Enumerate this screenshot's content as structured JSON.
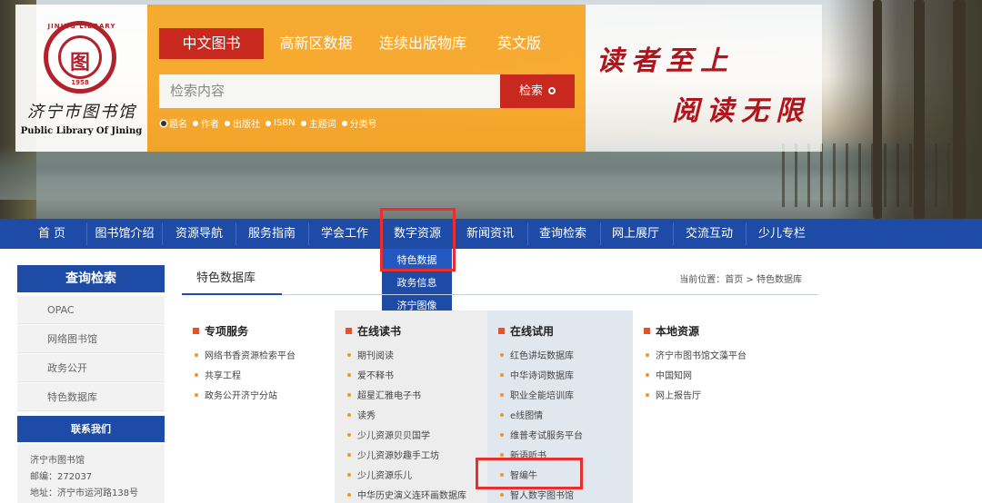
{
  "logo": {
    "cn": "济宁市图书馆",
    "en": "Public Library Of Jining",
    "seal_arc": "JINING LIBRARY",
    "seal_glyph": "图",
    "seal_year": "1958"
  },
  "search": {
    "tabs": [
      "中文图书",
      "高新区数据",
      "连续出版物库",
      "英文版"
    ],
    "active_tab": 0,
    "placeholder": "检索内容",
    "button": "检索",
    "options": [
      "题名",
      "作者",
      "出版社",
      "ISBN",
      "主题词",
      "分类号"
    ],
    "selected_option": 0
  },
  "slogan": {
    "line1": "读者至上",
    "line2": "阅读无限"
  },
  "nav": {
    "items": [
      "首 页",
      "图书馆介绍",
      "资源导航",
      "服务指南",
      "学会工作",
      "数字资源",
      "新闻资讯",
      "查询检索",
      "网上展厅",
      "交流互动",
      "少儿专栏"
    ],
    "dropdown": [
      "特色数据",
      "政务信息",
      "济宁图像"
    ]
  },
  "sidebar": {
    "title": "查询检索",
    "items": [
      "OPAC",
      "网络图书馆",
      "政务公开",
      "特色数据库"
    ],
    "contact_title": "联系我们",
    "contact": [
      "济宁市图书馆",
      "邮编：272037",
      "地址：济宁市运河路138号"
    ]
  },
  "main": {
    "title": "特色数据库",
    "breadcrumb": "当前位置：首页 > 特色数据库",
    "columns": [
      {
        "title": "专项服务",
        "items": [
          "网络书香资源检索平台",
          "共享工程",
          "政务公开济宁分站"
        ]
      },
      {
        "title": "在线读书",
        "items": [
          "期刊阅读",
          "爱不释书",
          "超星汇雅电子书",
          "读秀",
          "少儿资源贝贝国学",
          "少儿资源妙趣手工坊",
          "少儿资源乐儿",
          "中华历史演义连环画数据库"
        ]
      },
      {
        "title": "在线试用",
        "items": [
          "红色讲坛数据库",
          "中华诗词数据库",
          "职业全能培训库",
          "e线图情",
          "维普考试服务平台",
          "新语听书",
          "智编牛",
          "智人数字图书馆"
        ]
      },
      {
        "title": "本地资源",
        "items": [
          "济宁市图书馆文藻平台",
          "中国知网",
          "网上报告厅"
        ]
      }
    ]
  },
  "colors": {
    "nav_blue": "#1d4ba5",
    "search_orange": "#f7a624",
    "accent_red": "#c8281e",
    "highlight_red": "#ea2d2d",
    "bullet_orange": "#f2961f"
  }
}
